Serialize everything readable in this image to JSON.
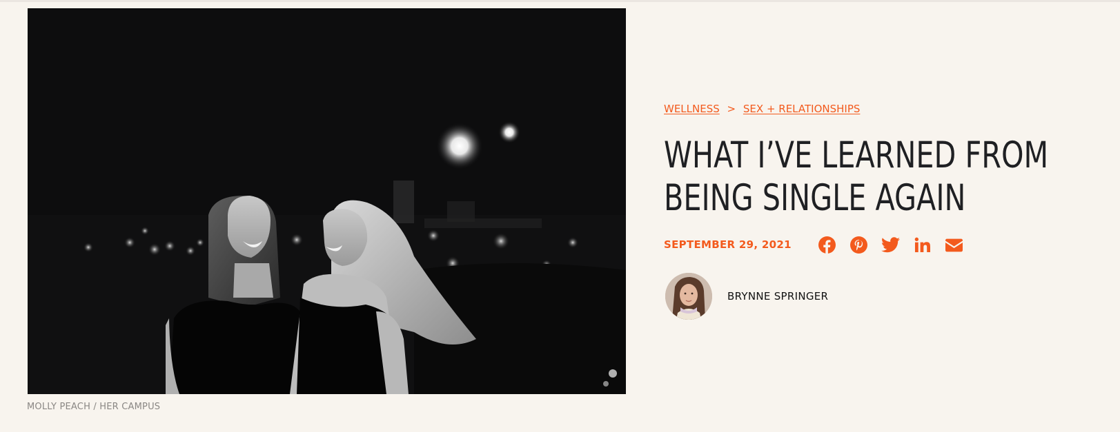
{
  "hero_image": {
    "alt": "Two women laughing outdoors at night",
    "credit": "MOLLY PEACH / HER CAMPUS"
  },
  "breadcrumb": {
    "items": [
      {
        "label": "WELLNESS"
      },
      {
        "label": "SEX + RELATIONSHIPS"
      }
    ],
    "separator": ">"
  },
  "article": {
    "title_lines": [
      "WHAT I’VE LEARNED FROM",
      "BEING SINGLE AGAIN"
    ],
    "date": "SEPTEMBER 29, 2021"
  },
  "share": {
    "icons": [
      "facebook-icon",
      "pinterest-icon",
      "twitter-icon",
      "linkedin-icon",
      "email-icon"
    ],
    "color": "#f35a1d"
  },
  "author": {
    "name": "BRYNNE SPRINGER"
  },
  "colors": {
    "accent": "#f35a1d",
    "background": "#f8f4ee",
    "heading": "#1f2023"
  }
}
